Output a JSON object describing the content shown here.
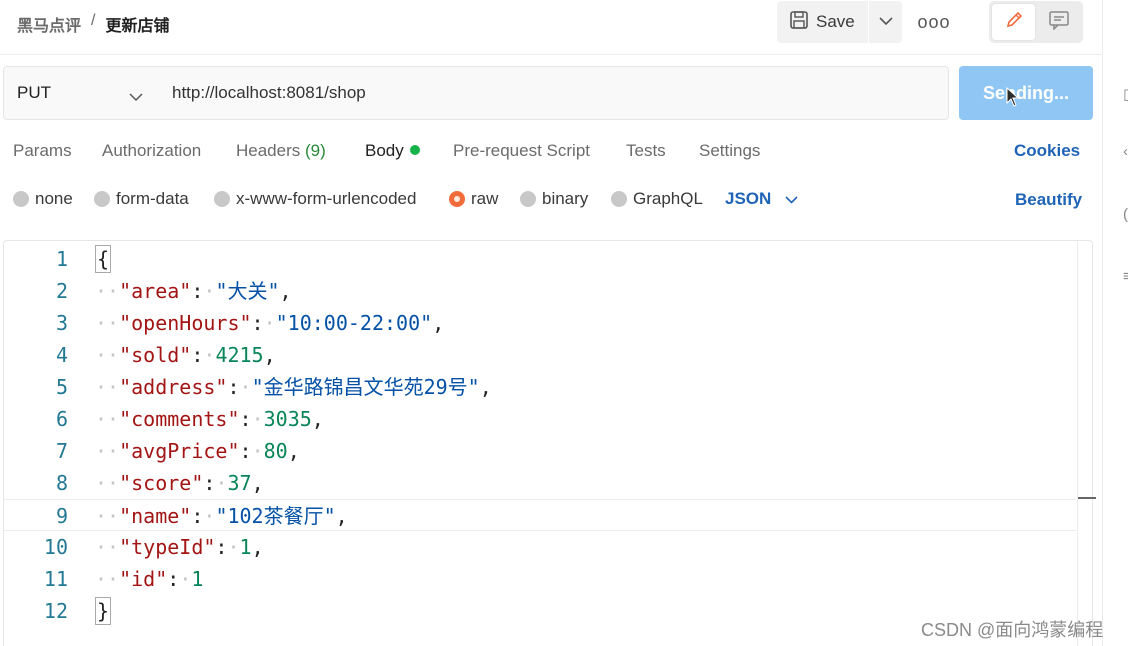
{
  "breadcrumb": {
    "collection": "黑马点评",
    "separator": "/",
    "request": "更新店铺"
  },
  "toolbar": {
    "save_label": "Save",
    "more_label": "ooo"
  },
  "request": {
    "method": "PUT",
    "url": "http://localhost:8081/shop",
    "send_label": "Sending..."
  },
  "tabs": [
    {
      "label": "Params"
    },
    {
      "label": "Authorization"
    },
    {
      "label": "Headers",
      "count": "(9)"
    },
    {
      "label": "Body",
      "active": true
    },
    {
      "label": "Pre-request Script"
    },
    {
      "label": "Tests"
    },
    {
      "label": "Settings"
    }
  ],
  "cookies_label": "Cookies",
  "body_types": [
    {
      "label": "none"
    },
    {
      "label": "form-data"
    },
    {
      "label": "x-www-form-urlencoded"
    },
    {
      "label": "raw",
      "selected": true
    },
    {
      "label": "binary"
    },
    {
      "label": "GraphQL"
    }
  ],
  "body_lang": "JSON",
  "beautify_label": "Beautify",
  "editor": {
    "lines": [
      {
        "num": "1",
        "key": "",
        "value": "",
        "type": "open"
      },
      {
        "num": "2",
        "key": "\"area\"",
        "value": "\"大关\"",
        "type": "str",
        "comma": ","
      },
      {
        "num": "3",
        "key": "\"openHours\"",
        "value": "\"10:00-22:00\"",
        "type": "str",
        "comma": ","
      },
      {
        "num": "4",
        "key": "\"sold\"",
        "value": "4215",
        "type": "num",
        "comma": ","
      },
      {
        "num": "5",
        "key": "\"address\"",
        "value": "\"金华路锦昌文华苑29号\"",
        "type": "str",
        "comma": ","
      },
      {
        "num": "6",
        "key": "\"comments\"",
        "value": "3035",
        "type": "num",
        "comma": ","
      },
      {
        "num": "7",
        "key": "\"avgPrice\"",
        "value": "80",
        "type": "num",
        "comma": ","
      },
      {
        "num": "8",
        "key": "\"score\"",
        "value": "37",
        "type": "num",
        "comma": ","
      },
      {
        "num": "9",
        "key": "\"name\"",
        "value": "\"102茶餐厅\"",
        "type": "str",
        "comma": ",",
        "highlight": true
      },
      {
        "num": "10",
        "key": "\"typeId\"",
        "value": "1",
        "type": "num",
        "comma": ","
      },
      {
        "num": "11",
        "key": "\"id\"",
        "value": "1",
        "type": "num",
        "comma": ""
      },
      {
        "num": "12",
        "key": "",
        "value": "",
        "type": "close"
      }
    ]
  },
  "watermark": "CSDN @面向鸿蒙编程",
  "colors": {
    "send_bg": "#8fc6f4",
    "accent_blue": "#1f64b6",
    "raw_selected": "#f26b3a",
    "body_dot": "#17b34a"
  }
}
